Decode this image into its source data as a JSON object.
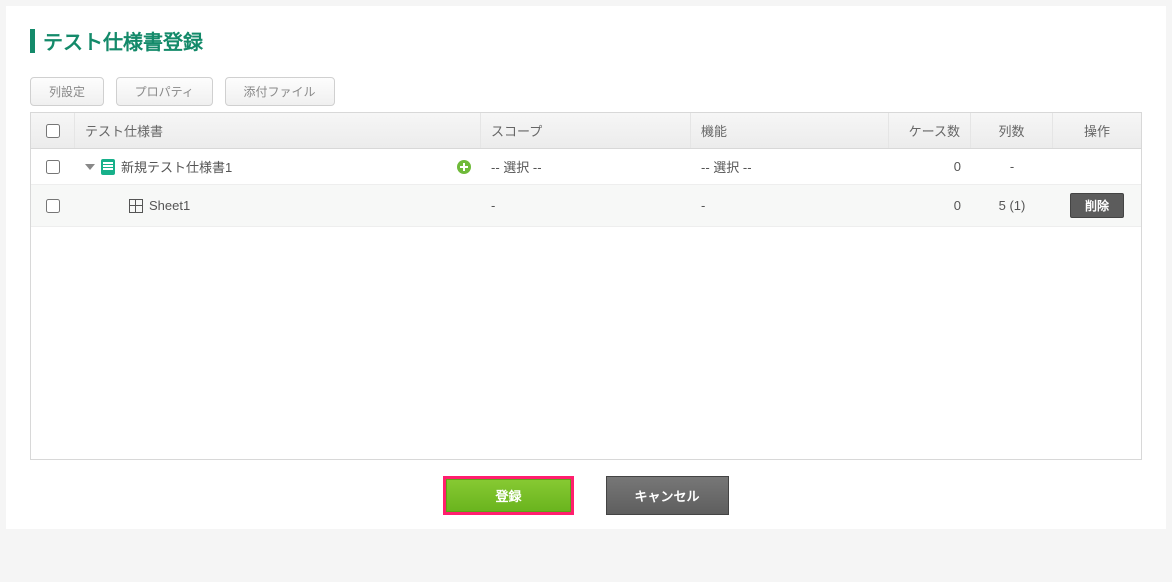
{
  "title": "テスト仕様書登録",
  "toolbar": {
    "col_settings": "列設定",
    "properties": "プロパティ",
    "attachments": "添付ファイル"
  },
  "headers": {
    "spec": "テスト仕様書",
    "scope": "スコープ",
    "function": "機能",
    "cases": "ケース数",
    "columns": "列数",
    "action": "操作"
  },
  "rows": [
    {
      "name": "新規テスト仕様書1",
      "scope": "-- 選択 --",
      "function": "-- 選択 --",
      "cases": "0",
      "columns": "-",
      "action": ""
    },
    {
      "name": "Sheet1",
      "scope": "-",
      "function": "-",
      "cases": "0",
      "columns": "5 (1)",
      "action": "削除"
    }
  ],
  "footer": {
    "submit": "登録",
    "cancel": "キャンセル"
  }
}
